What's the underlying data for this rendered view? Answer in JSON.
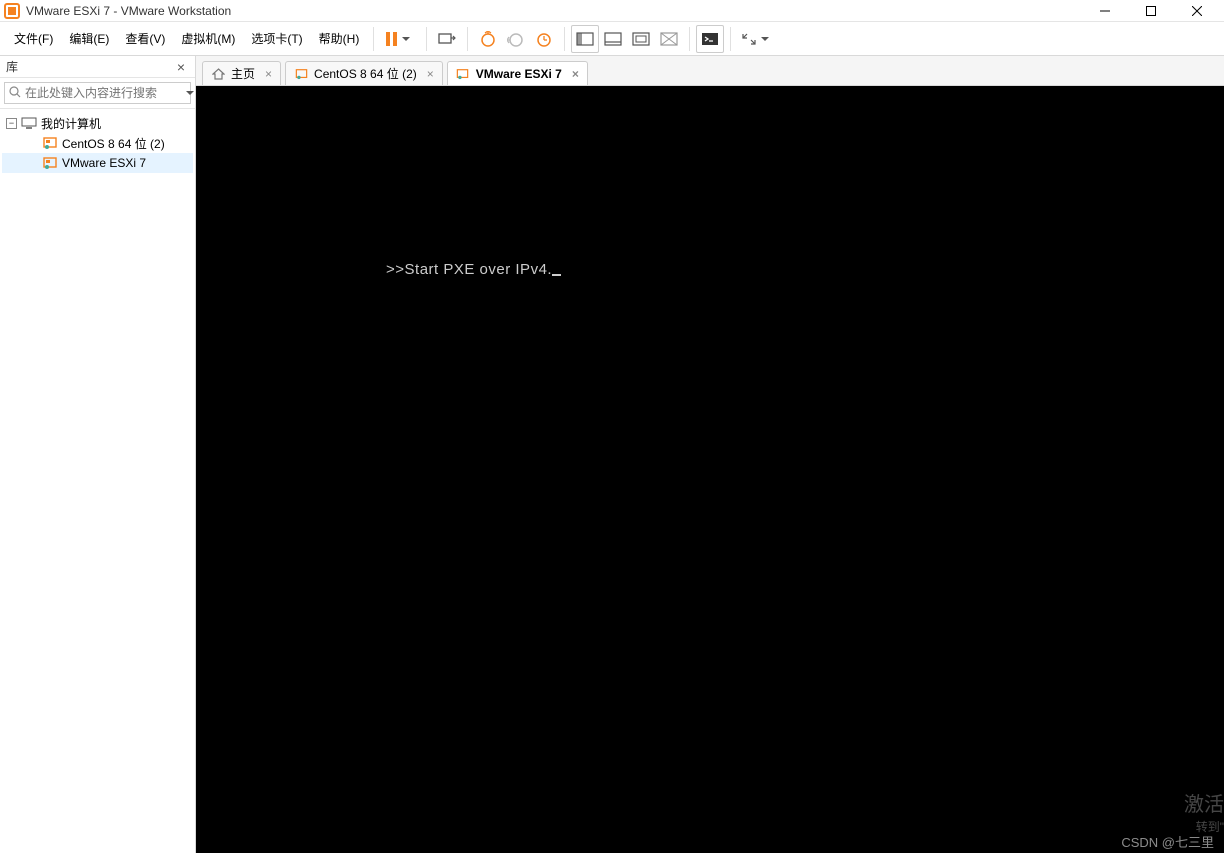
{
  "window": {
    "title": "VMware ESXi 7 - VMware Workstation"
  },
  "menu": {
    "file": "文件(F)",
    "edit": "编辑(E)",
    "view": "查看(V)",
    "vm": "虚拟机(M)",
    "tabs": "选项卡(T)",
    "help": "帮助(H)"
  },
  "sidebar": {
    "header": "库",
    "search_placeholder": "在此处键入内容进行搜索",
    "root": "我的计算机",
    "items": [
      {
        "label": "CentOS 8 64 位 (2)",
        "selected": false
      },
      {
        "label": "VMware ESXi 7",
        "selected": true
      }
    ]
  },
  "tabs": [
    {
      "label": "主页",
      "icon": "home",
      "active": false
    },
    {
      "label": "CentOS 8 64 位 (2)",
      "icon": "vm",
      "active": false
    },
    {
      "label": "VMware ESXi 7",
      "icon": "vm",
      "active": true
    }
  ],
  "console": {
    "line1": ">>Start PXE over IPv4."
  },
  "watermark": {
    "activate": "激活",
    "goto": "转到\"",
    "csdn": "CSDN @七三里"
  },
  "colors": {
    "accent_orange": "#f58220",
    "pause_orange": "#f58220"
  }
}
